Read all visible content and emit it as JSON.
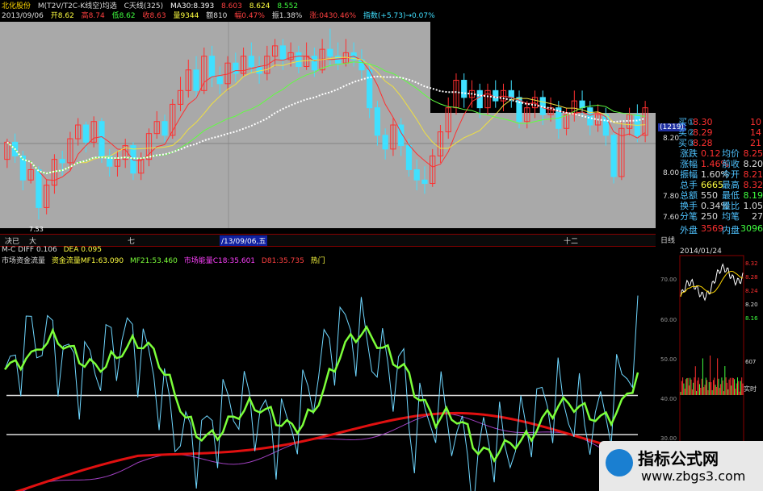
{
  "header": {
    "line1": {
      "stock_name": "北化股份",
      "formula": "M(T2V/T2C-K线空)均选",
      "ktype": "C天线(325)",
      "ma30": "MA30:8.393",
      "v1": "8.603",
      "v2": "8.624",
      "v3": "8.552"
    },
    "line2": {
      "date": "2013/09/06",
      "open": "开8.62",
      "high": "高8.74",
      "low": "低8.62",
      "close": "收8.63",
      "volume": "量9344",
      "amount": "额810",
      "change": "幅0.47%",
      "amplitude": "振1.38%",
      "chg2": "涨:0430.46%",
      "index": "指数(+5.73)→0.07%"
    }
  },
  "main_chart": {
    "price_labels": [
      "(1219)",
      "8.20",
      "8.00",
      "7.80",
      "7.60"
    ],
    "low_label": "7.53",
    "candles": [
      [
        7.9,
        8.0,
        7.85,
        8.02
      ],
      [
        8.0,
        7.92,
        7.88,
        8.05
      ],
      [
        7.92,
        7.78,
        7.72,
        7.95
      ],
      [
        7.78,
        7.84,
        7.76,
        7.88
      ],
      [
        7.84,
        7.62,
        7.55,
        7.86
      ],
      [
        7.62,
        7.75,
        7.58,
        7.78
      ],
      [
        7.75,
        7.9,
        7.7,
        7.93
      ],
      [
        7.9,
        7.88,
        7.8,
        7.95
      ],
      [
        7.88,
        8.02,
        7.84,
        8.06
      ],
      [
        8.02,
        8.1,
        7.98,
        8.14
      ],
      [
        8.1,
        8.0,
        7.94,
        8.12
      ],
      [
        8.0,
        8.12,
        7.97,
        8.15
      ],
      [
        8.12,
        7.92,
        7.88,
        8.14
      ],
      [
        7.92,
        7.86,
        7.8,
        7.96
      ],
      [
        7.86,
        7.9,
        7.8,
        7.95
      ],
      [
        7.9,
        7.98,
        7.85,
        8.02
      ],
      [
        7.98,
        7.82,
        7.78,
        8.0
      ],
      [
        7.82,
        7.9,
        7.78,
        7.94
      ],
      [
        7.9,
        8.05,
        7.86,
        8.08
      ],
      [
        8.05,
        8.12,
        8.02,
        8.18
      ],
      [
        8.12,
        8.04,
        8.0,
        8.16
      ],
      [
        8.04,
        8.22,
        8.02,
        8.25
      ],
      [
        8.22,
        8.3,
        8.18,
        8.38
      ],
      [
        8.3,
        8.42,
        8.26,
        8.48
      ],
      [
        8.42,
        8.3,
        8.25,
        8.5
      ],
      [
        8.3,
        8.5,
        8.28,
        8.55
      ],
      [
        8.5,
        8.38,
        8.32,
        8.56
      ],
      [
        8.38,
        8.34,
        8.28,
        8.44
      ],
      [
        8.34,
        8.46,
        8.3,
        8.5
      ],
      [
        8.46,
        8.4,
        8.35,
        8.52
      ],
      [
        8.4,
        8.5,
        8.38,
        8.55
      ],
      [
        8.5,
        8.44,
        8.4,
        8.58
      ],
      [
        8.44,
        8.4,
        8.34,
        8.5
      ],
      [
        8.4,
        8.5,
        8.36,
        8.56
      ],
      [
        8.5,
        8.56,
        8.44,
        8.6
      ],
      [
        8.56,
        8.48,
        8.42,
        8.6
      ],
      [
        8.48,
        8.52,
        8.44,
        8.58
      ],
      [
        8.52,
        8.44,
        8.4,
        8.56
      ],
      [
        8.44,
        8.5,
        8.42,
        8.58
      ],
      [
        8.5,
        8.42,
        8.38,
        8.55
      ],
      [
        8.42,
        8.54,
        8.4,
        8.6
      ],
      [
        8.54,
        8.5,
        8.44,
        8.66
      ],
      [
        8.5,
        8.46,
        8.42,
        8.58
      ],
      [
        8.46,
        8.52,
        8.44,
        8.6
      ],
      [
        8.52,
        8.48,
        8.44,
        8.58
      ],
      [
        8.48,
        8.42,
        8.36,
        8.54
      ],
      [
        8.42,
        8.2,
        8.14,
        8.46
      ],
      [
        8.2,
        8.04,
        7.98,
        8.24
      ],
      [
        8.04,
        7.96,
        7.9,
        8.08
      ],
      [
        7.96,
        8.1,
        7.92,
        8.14
      ],
      [
        8.1,
        7.98,
        7.92,
        8.14
      ],
      [
        7.98,
        7.84,
        7.8,
        8.02
      ],
      [
        7.84,
        7.78,
        7.72,
        7.9
      ],
      [
        7.78,
        7.76,
        7.7,
        7.86
      ],
      [
        7.76,
        7.92,
        7.74,
        7.96
      ],
      [
        7.92,
        8.06,
        7.88,
        8.1
      ],
      [
        8.06,
        8.2,
        8.02,
        8.26
      ],
      [
        8.2,
        8.36,
        8.16,
        8.4
      ],
      [
        8.36,
        8.26,
        8.2,
        8.4
      ],
      [
        8.26,
        8.3,
        8.2,
        8.36
      ],
      [
        8.3,
        8.2,
        8.14,
        8.34
      ],
      [
        8.2,
        8.3,
        8.16,
        8.34
      ],
      [
        8.3,
        8.24,
        8.2,
        8.36
      ],
      [
        8.24,
        8.3,
        8.18,
        8.34
      ],
      [
        8.3,
        8.26,
        8.2,
        8.36
      ],
      [
        8.26,
        8.12,
        8.08,
        8.3
      ],
      [
        8.12,
        8.2,
        8.08,
        8.24
      ],
      [
        8.2,
        8.26,
        8.14,
        8.3
      ],
      [
        8.26,
        8.16,
        8.1,
        8.3
      ],
      [
        8.16,
        8.2,
        8.12,
        8.26
      ],
      [
        8.2,
        8.08,
        8.02,
        8.24
      ],
      [
        8.08,
        8.16,
        8.04,
        8.2
      ],
      [
        8.16,
        8.24,
        8.12,
        8.3
      ],
      [
        8.24,
        8.2,
        8.14,
        8.3
      ],
      [
        8.2,
        8.1,
        8.04,
        8.24
      ],
      [
        8.1,
        8.16,
        8.06,
        8.22
      ],
      [
        8.16,
        8.04,
        7.98,
        8.2
      ],
      [
        8.04,
        7.8,
        7.76,
        8.08
      ],
      [
        7.8,
        8.08,
        7.78,
        8.12
      ],
      [
        8.08,
        8.16,
        8.04,
        8.2
      ],
      [
        8.16,
        8.04,
        8.0,
        8.22
      ],
      [
        8.04,
        8.2,
        8.0,
        8.24
      ]
    ]
  },
  "strip": {
    "left_label": "决已",
    "big": "大",
    "seven": "七",
    "date_label": "/13/09/06,五",
    "twelve": "十二",
    "right_label": "日线"
  },
  "legend": {
    "line1": {
      "macd": "M-C DIFF 0.106",
      "dea": "DEA 0.095"
    },
    "line2": {
      "name": "市场资金流量",
      "item1": "资金流量MF1:63.090",
      "item2": "MF21:53.460",
      "item3": "市场能量C18:35.601",
      "item4": "D81:35.735",
      "item5": "热门"
    }
  },
  "quote": {
    "bids": [
      {
        "label": "买①",
        "price": "8.30",
        "vol": "10"
      },
      {
        "label": "买②",
        "price": "8.29",
        "vol": "14"
      },
      {
        "label": "买③",
        "price": "8.28",
        "vol": "21"
      }
    ],
    "stats": [
      {
        "a": "涨跌",
        "b": "0.12",
        "c": "均价",
        "d": "8.25"
      },
      {
        "a": "涨幅",
        "b": "1.46%",
        "c": "前收",
        "d": "8.20"
      },
      {
        "a": "振幅",
        "b": "1.60%",
        "c": "今开",
        "d": "8.21"
      },
      {
        "a": "总手",
        "b": "6665",
        "c": "最高",
        "d": "8.32"
      },
      {
        "a": "总额",
        "b": "550",
        "c": "最低",
        "d": "8.19"
      },
      {
        "a": "换手",
        "b": "0.34%",
        "c": "量比",
        "d": "1.05"
      },
      {
        "a": "分笔",
        "b": "250",
        "c": "均笔",
        "d": "27"
      }
    ],
    "outer_label": "外盘",
    "outer_value": "3569",
    "inner_label": "内盘",
    "inner_value": "3096",
    "date": "2014/01/24",
    "mini_prices": [
      "8.32",
      "8.28",
      "8.24",
      "8.20",
      "8.16"
    ],
    "mini_axis": [
      "70.00",
      "60.00",
      "50.00",
      "40.00",
      "30.00"
    ],
    "vol_label": "607",
    "realtime": "实时"
  },
  "sub_chart": {
    "levels": [
      "70.00",
      "60.00",
      "50.00",
      "40.00"
    ],
    "h_lines": [
      50,
      41
    ]
  },
  "watermark": {
    "title": "指标公式网",
    "url": "www.zbgs3.com"
  },
  "colors": {
    "up": "#ff3030",
    "down": "#40e0ff",
    "ma_yellow": "#f0e040",
    "ma_green": "#60ff40",
    "ma_white": "#ffffff",
    "sub_green": "#7cff3a",
    "sub_cyan": "#6fd7ff",
    "sub_red": "#e01010",
    "sub_purple": "#a040c0"
  }
}
